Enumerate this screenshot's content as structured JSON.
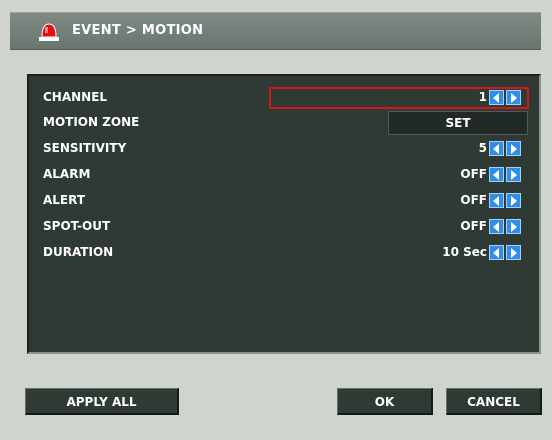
{
  "title": "EVENT > MOTION",
  "rows": [
    {
      "label": "CHANNEL",
      "value": "1"
    },
    {
      "label": "MOTION ZONE",
      "value": "SET"
    },
    {
      "label": "SENSITIVITY",
      "value": "5"
    },
    {
      "label": "ALARM",
      "value": "OFF"
    },
    {
      "label": "ALERT",
      "value": "OFF"
    },
    {
      "label": "SPOT-OUT",
      "value": "OFF"
    },
    {
      "label": "DURATION",
      "value": "10 Sec"
    }
  ],
  "buttons": {
    "apply_all": "APPLY ALL",
    "ok": "OK",
    "cancel": "CANCEL"
  },
  "colors": {
    "panel": "#2f3a34",
    "accent_arrow": "#2f8fe8",
    "selection": "#d01818",
    "alarm_icon": "#e01010"
  },
  "icons": {
    "title": "siren-icon",
    "decrease": "arrow-left-icon",
    "increase": "arrow-right-icon"
  }
}
